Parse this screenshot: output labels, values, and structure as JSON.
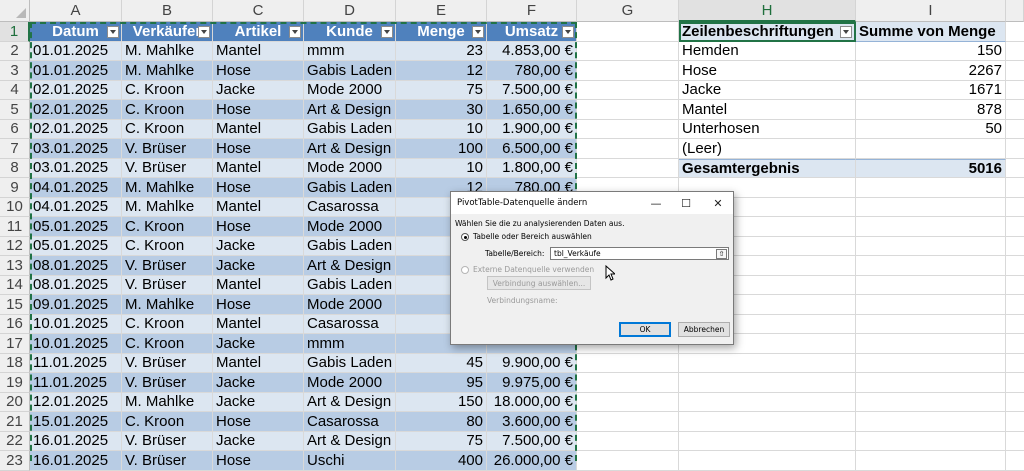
{
  "columns": [
    "A",
    "B",
    "C",
    "D",
    "E",
    "F",
    "G",
    "H",
    "I"
  ],
  "selected_column": "H",
  "selected_row": "1",
  "table": {
    "headers": [
      "Datum",
      "Verkäufer",
      "Artikel",
      "Kunde",
      "Menge",
      "Umsatz"
    ],
    "rows": [
      [
        "01.01.2025",
        "M. Mahlke",
        "Mantel",
        "mmm",
        "23",
        "4.853,00 €"
      ],
      [
        "01.01.2025",
        "M. Mahlke",
        "Hose",
        "Gabis Laden",
        "12",
        "780,00 €"
      ],
      [
        "02.01.2025",
        "C. Kroon",
        "Jacke",
        "Mode 2000",
        "75",
        "7.500,00 €"
      ],
      [
        "02.01.2025",
        "C. Kroon",
        "Hose",
        "Art & Design",
        "30",
        "1.650,00 €"
      ],
      [
        "02.01.2025",
        "C. Kroon",
        "Mantel",
        "Gabis Laden",
        "10",
        "1.900,00 €"
      ],
      [
        "03.01.2025",
        "V. Brüser",
        "Hose",
        "Art & Design",
        "100",
        "6.500,00 €"
      ],
      [
        "03.01.2025",
        "V. Brüser",
        "Mantel",
        "Mode 2000",
        "10",
        "1.800,00 €"
      ],
      [
        "04.01.2025",
        "M. Mahlke",
        "Hose",
        "Gabis Laden",
        "12",
        "780,00 €"
      ],
      [
        "04.01.2025",
        "M. Mahlke",
        "Mantel",
        "Casarossa",
        "",
        ""
      ],
      [
        "05.01.2025",
        "C. Kroon",
        "Hose",
        "Mode 2000",
        "",
        ""
      ],
      [
        "05.01.2025",
        "C. Kroon",
        "Jacke",
        "Gabis Laden",
        "",
        ""
      ],
      [
        "08.01.2025",
        "V. Brüser",
        "Jacke",
        "Art & Design",
        "",
        ""
      ],
      [
        "08.01.2025",
        "V. Brüser",
        "Mantel",
        "Gabis Laden",
        "",
        ""
      ],
      [
        "09.01.2025",
        "M. Mahlke",
        "Hose",
        "Mode 2000",
        "",
        ""
      ],
      [
        "10.01.2025",
        "C. Kroon",
        "Mantel",
        "Casarossa",
        "",
        ""
      ],
      [
        "10.01.2025",
        "C. Kroon",
        "Jacke",
        "mmm",
        "",
        ""
      ],
      [
        "11.01.2025",
        "V. Brüser",
        "Mantel",
        "Gabis Laden",
        "45",
        "9.900,00 €"
      ],
      [
        "11.01.2025",
        "V. Brüser",
        "Jacke",
        "Mode 2000",
        "95",
        "9.975,00 €"
      ],
      [
        "12.01.2025",
        "M. Mahlke",
        "Jacke",
        "Art & Design",
        "150",
        "18.000,00 €"
      ],
      [
        "15.01.2025",
        "C. Kroon",
        "Hose",
        "Casarossa",
        "80",
        "3.600,00 €"
      ],
      [
        "16.01.2025",
        "V. Brüser",
        "Jacke",
        "Art & Design",
        "75",
        "7.500,00 €"
      ],
      [
        "16.01.2025",
        "V. Brüser",
        "Hose",
        "Uschi",
        "400",
        "26.000,00 €"
      ]
    ]
  },
  "pivot": {
    "row_header": "Zeilenbeschriftungen",
    "value_header": "Summe von Menge",
    "rows": [
      {
        "label": "Hemden",
        "value": "150"
      },
      {
        "label": "Hose",
        "value": "2267"
      },
      {
        "label": "Jacke",
        "value": "1671"
      },
      {
        "label": "Mantel",
        "value": "878"
      },
      {
        "label": "Unterhosen",
        "value": "50"
      },
      {
        "label": "(Leer)",
        "value": ""
      }
    ],
    "total_label": "Gesamtergebnis",
    "total_value": "5016"
  },
  "dialog": {
    "title": "PivotTable-Datenquelle ändern",
    "minimize": "—",
    "maximize": "☐",
    "close": "✕",
    "instruction": "Wählen Sie die zu analysierenden Daten aus.",
    "option_table": "Tabelle oder Bereich auswählen",
    "range_label": "Tabelle/Bereich:",
    "range_value": "tbl_Verkäufe",
    "option_external": "Externe Datenquelle verwenden",
    "choose_connection": "Verbindung auswählen...",
    "connection_name": "Verbindungsname:",
    "ok": "OK",
    "cancel": "Abbrechen"
  }
}
